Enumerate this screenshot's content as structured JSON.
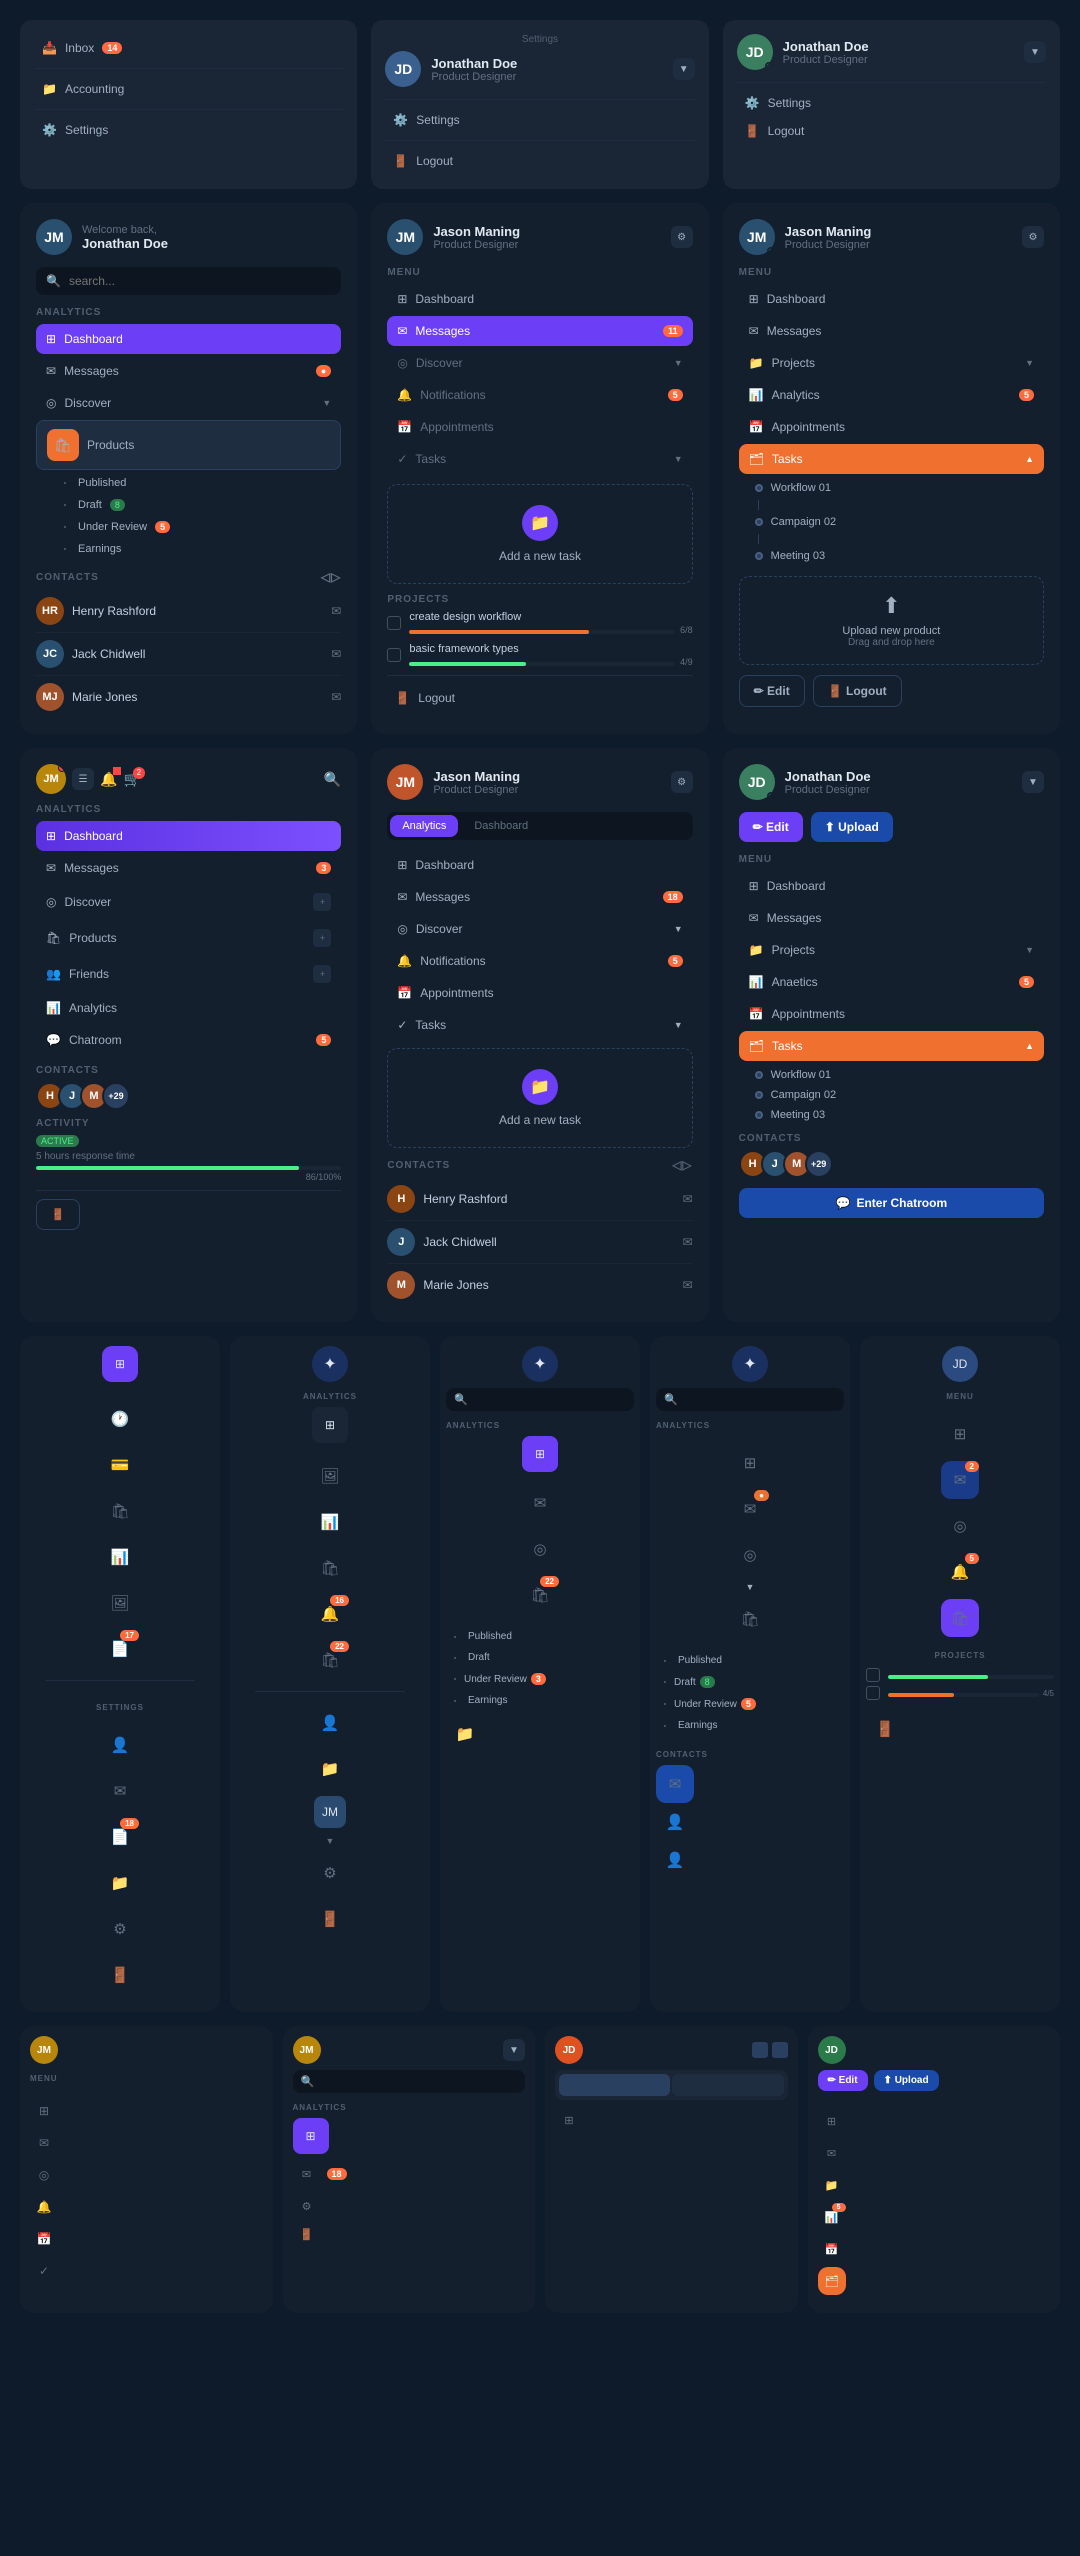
{
  "colors": {
    "bg": "#0d1b2a",
    "card": "#141f2e",
    "accent_purple": "#6c3ef5",
    "accent_orange": "#f07030",
    "accent_blue": "#1a4aaa",
    "accent_green": "#4aef8a",
    "text_primary": "#e0e8f0",
    "text_secondary": "#a0b0c0",
    "text_muted": "#506070"
  },
  "user1": {
    "name": "Jonathan Doe",
    "role": "Product Designer"
  },
  "user2": {
    "name": "Jason Maning",
    "role": "Product Designer"
  },
  "menus": {
    "row1_col1": {
      "items": [
        "Inbox",
        "Accounting",
        "Settings"
      ]
    },
    "row1_col2": {
      "user": "Jonathan Doe",
      "role": "Product Designer",
      "items": [
        "Settings",
        "Logout"
      ]
    },
    "row1_col3": {
      "user": "Jonathan Doe",
      "role": "Product Designer",
      "items": [
        "Settings",
        "Logout"
      ]
    }
  },
  "sidebar": {
    "welcome": "Welcome back,",
    "user": "Jonathan Doe",
    "search_placeholder": "search...",
    "analytics_label": "ANALYTICS",
    "nav_items": [
      {
        "label": "Dashboard",
        "active": true
      },
      {
        "label": "Messages",
        "badge": "orange"
      },
      {
        "label": "Discover",
        "has_arrow": true
      },
      {
        "label": "Products",
        "active_outline": true
      }
    ],
    "sub_items": [
      "Published",
      "Draft",
      "Under Review",
      "Earnings"
    ],
    "draft_badge": "8",
    "under_review_badge": "5",
    "contacts_label": "CONTACTS",
    "contacts": [
      {
        "name": "Henry Rashford"
      },
      {
        "name": "Jack Chidwell"
      },
      {
        "name": "Marie Jones"
      }
    ]
  },
  "panel_messages": {
    "menu_label": "MENU",
    "items": [
      "Dashboard",
      "Messages",
      "Discover",
      "Notifications",
      "Appointments",
      "Tasks"
    ],
    "messages_badge": "11",
    "notifications_badge": "5",
    "task_add_label": "Add a new task",
    "projects_label": "PROJECTS",
    "projects": [
      {
        "name": "create design workflow",
        "progress": 68,
        "label": "6/8"
      },
      {
        "name": "basic framework types",
        "progress": 44,
        "label": "4/9"
      }
    ],
    "logout_label": "Logout",
    "contacts": [
      "Henry Rashford",
      "Jack Chidwell",
      "Marie Jones"
    ]
  },
  "panel_tasks": {
    "menu_label": "MENU",
    "items": [
      "Dashboard",
      "Messages",
      "Projects",
      "Analytics",
      "Appointments",
      "Tasks"
    ],
    "analytics_badge": "5",
    "tasks_active": true,
    "workflow_items": [
      "Workflow 01",
      "Campaign 02",
      "Meeting 03"
    ],
    "upload_label": "Upload new product",
    "upload_sub": "Drag and drop here",
    "edit_label": "Edit",
    "logout_label": "Logout"
  },
  "panel_analytics": {
    "tabs": [
      "Analytics",
      "Dashboard"
    ],
    "active_tab": "Analytics",
    "items": [
      "Dashboard",
      "Messages",
      "Discover",
      "Notifications",
      "Appointments",
      "Tasks"
    ],
    "messages_badge": "18",
    "notifications_badge": "5",
    "task_add_label": "Add a new task",
    "contacts_label": "CONTACTS",
    "contacts": [
      "Henry Rashford",
      "Jack Chidwell",
      "Marie Jones"
    ]
  },
  "panel_chatroom": {
    "user": "Jonathan Doe",
    "role": "Product Designer",
    "edit_label": "Edit",
    "upload_label": "Upload",
    "menu_label": "MENU",
    "items": [
      "Dashboard",
      "Messages",
      "Projects",
      "Anaetics",
      "Appointments",
      "Tasks"
    ],
    "analytics_badge": "5",
    "tasks_active": true,
    "workflow_items": [
      "Workflow 01",
      "Campaign 02",
      "Meeting 03"
    ],
    "contacts_label": "CONTACTS",
    "chatroom_label": "Enter Chatroom"
  },
  "panel_mobile1": {
    "analytics_label": "ANALYTICS",
    "nav_items": [
      "Dashboard",
      "Messages",
      "Discover",
      "Products",
      "Friends",
      "Analytics",
      "Chatroom"
    ],
    "chatroom_badge": "5",
    "messages_badge": "3",
    "contacts_label": "CONTACTS",
    "activity_label": "ACTIVITY",
    "activity_status": "ACTIVE",
    "activity_time": "5 hours response time",
    "activity_pct": "86/100%"
  },
  "icons_row": {
    "items": [
      "grid",
      "clock",
      "wallet",
      "bag",
      "chart",
      "image",
      "file",
      "settings",
      "person",
      "mail",
      "folder",
      "gear",
      "logout"
    ],
    "notifications_badge": "17",
    "settings_label": "SETTINGS"
  },
  "sub_menus": {
    "products_items": [
      "Published",
      "Draft",
      "Under Review",
      "Earnings"
    ],
    "under_review_badge": "3",
    "under_review_badge2": "5",
    "draft_badge": "8"
  },
  "bottom_row": {
    "menu_label": "MENU",
    "analytics_label": "ANALYTICS",
    "search_placeholder": "search...",
    "notifications_badge": "18",
    "dashboard_active": true
  }
}
